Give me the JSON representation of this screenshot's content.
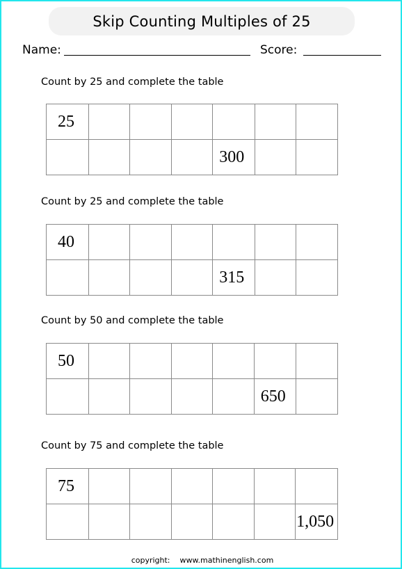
{
  "header": {
    "title": "Skip Counting Multiples of 25",
    "name_label": "Name:",
    "score_label": "Score:"
  },
  "exercises": [
    {
      "instruction": "Count by 25 and complete the table",
      "start_value": "25",
      "given_value": "300",
      "given_cell": {
        "row": 2,
        "column": 5
      }
    },
    {
      "instruction": "Count by 25 and complete the table",
      "start_value": "40",
      "given_value": "315",
      "given_cell": {
        "row": 2,
        "column": 5
      }
    },
    {
      "instruction": "Count by 50 and complete the table",
      "start_value": "50",
      "given_value": "650",
      "given_cell": {
        "row": 2,
        "column": 6
      }
    },
    {
      "instruction": "Count by 75 and complete the table",
      "start_value": "75",
      "given_value": "1,050",
      "given_cell": {
        "row": 2,
        "column": 7
      }
    }
  ],
  "footer": {
    "copyright_label": "copyright:",
    "website": "www.mathinenglish.com"
  },
  "colors": {
    "page_border": "#22e6ec",
    "title_background": "#f2f2f2",
    "grid_lines": "#8a8a8a"
  }
}
